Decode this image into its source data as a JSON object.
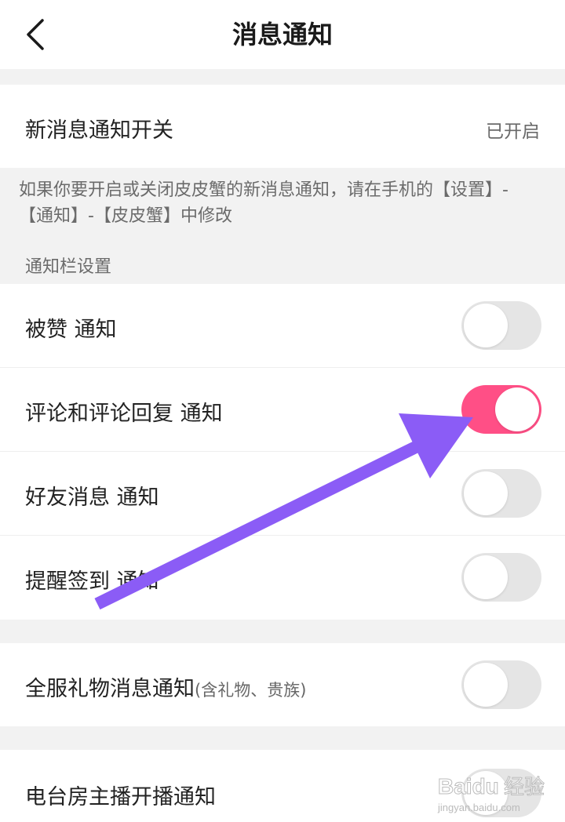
{
  "nav": {
    "title": "消息通知",
    "back_icon": "chevron-left-icon"
  },
  "master_switch": {
    "label": "新消息通知开关",
    "status": "已开启"
  },
  "tip": "如果你要开启或关闭皮皮蟹的新消息通知，请在手机的【设置】-【通知】-【皮皮蟹】中修改",
  "section_title": "通知栏设置",
  "notifications": [
    {
      "label": "被赞 通知",
      "enabled": false
    },
    {
      "label": "评论和评论回复 通知",
      "enabled": true
    },
    {
      "label": "好友消息 通知",
      "enabled": false
    },
    {
      "label": "提醒签到 通知",
      "enabled": false
    }
  ],
  "gift": {
    "label": "全服礼物消息通知",
    "sub": "(含礼物、贵族)",
    "enabled": false
  },
  "radio": {
    "label": "电台房主播开播通知",
    "enabled": false
  },
  "watermark": {
    "brand": "Baidu",
    "brand_cn": "经验",
    "url": "jingyan.baidu.com"
  },
  "colors": {
    "accent": "#ff4f86",
    "annotation_arrow": "#8b5cf6",
    "section_bg": "#f2f2f2",
    "toggle_off": "#e5e5e5"
  }
}
